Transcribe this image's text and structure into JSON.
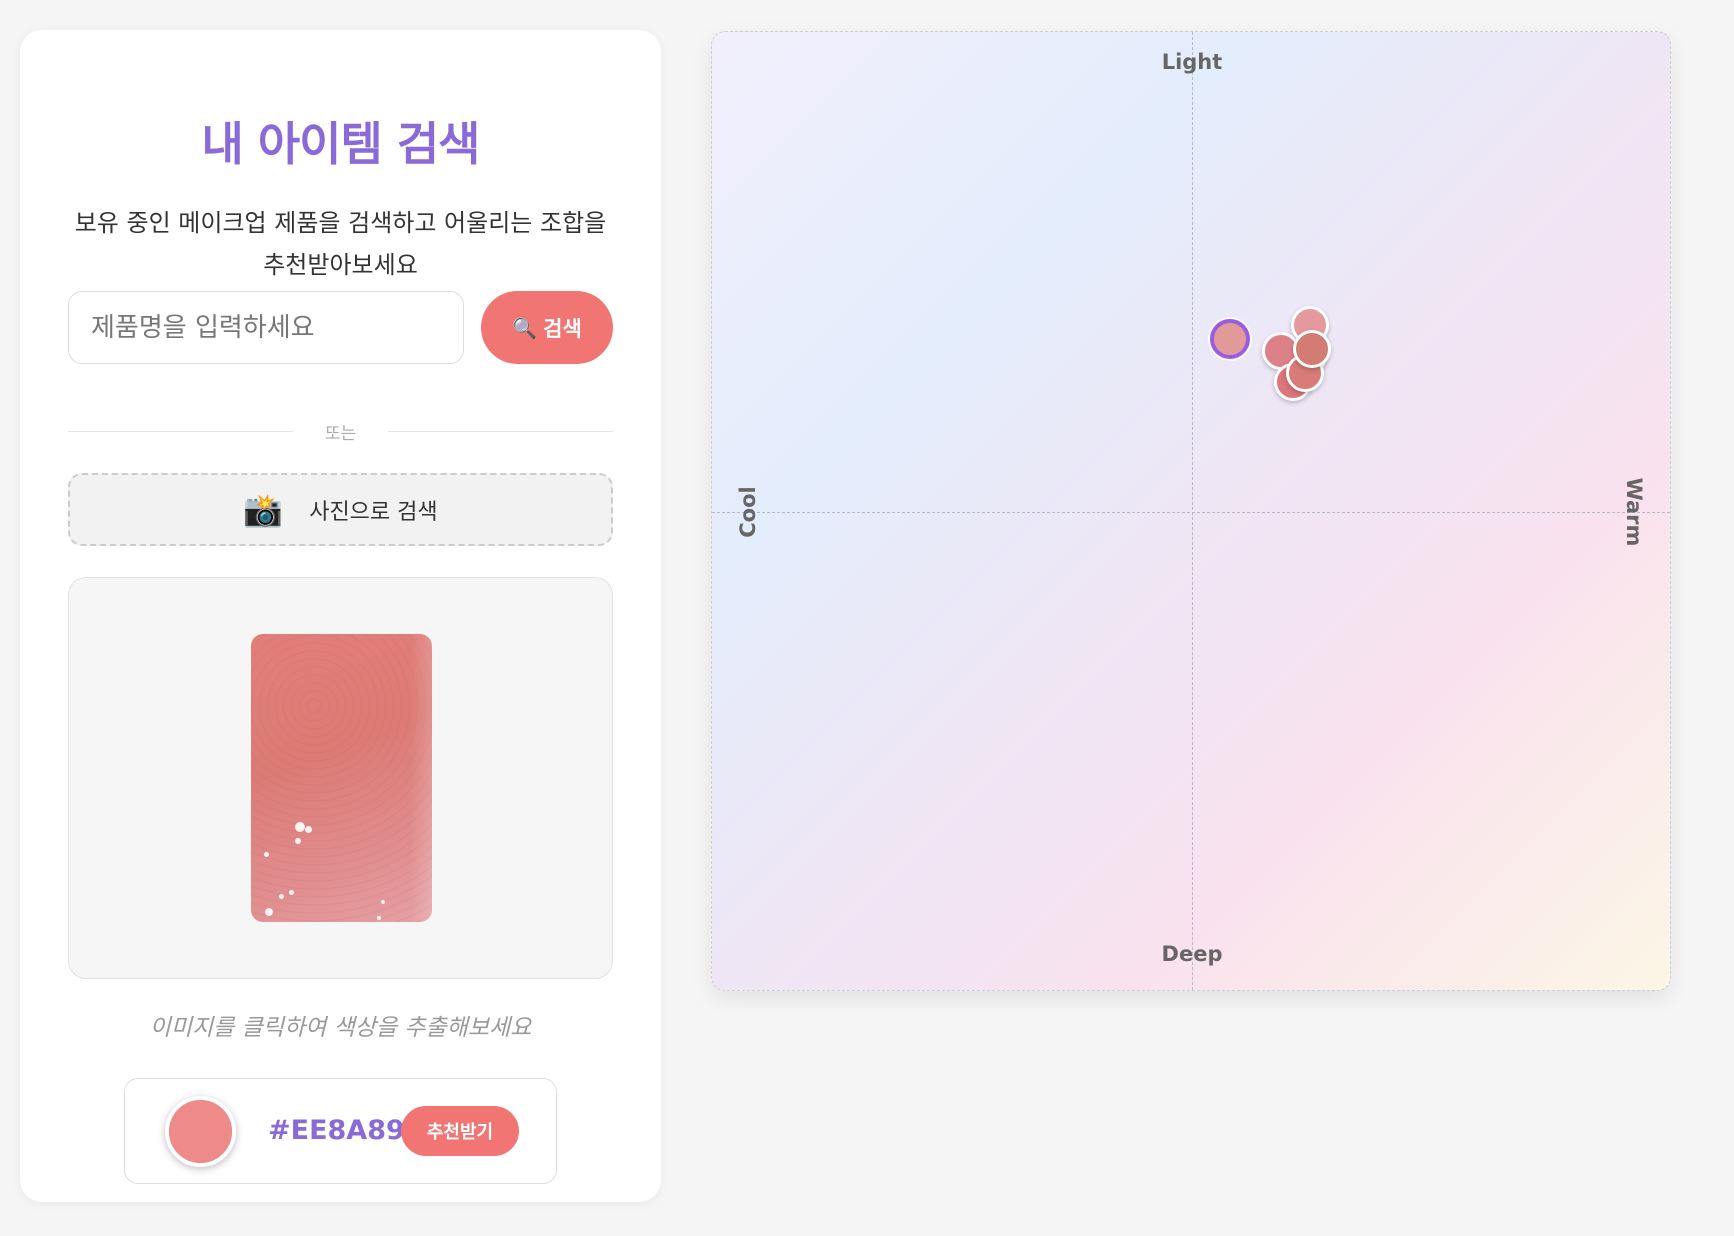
{
  "search_panel": {
    "title": "내 아이템 검색",
    "subtitle": "보유 중인 메이크업 제품을 검색하고 어울리는 조합을 추천받아보세요",
    "search_input": {
      "placeholder": "제품명을 입력하세요",
      "value": ""
    },
    "search_button": {
      "icon": "🔍",
      "label": "검색"
    },
    "divider_text": "또는",
    "photo_search_button": {
      "icon": "📸",
      "label": "사진으로 검색"
    },
    "image_hint": "이미지를 클릭하여 색상을 추출해보세요",
    "extracted_color": {
      "hex": "#EE8A89",
      "recommend_label": "추천받기"
    }
  },
  "color_map": {
    "axis_labels": {
      "top": "Light",
      "bottom": "Deep",
      "left": "Cool",
      "right": "Warm"
    },
    "selected_point": {
      "warmth": 0.08,
      "lightness": 0.36,
      "color": "#e1999a"
    },
    "points": [
      {
        "warmth": 0.245,
        "lightness": 0.39,
        "color": "#e49a9c"
      },
      {
        "warmth": 0.24,
        "lightness": 0.32,
        "color": "#de7b80"
      },
      {
        "warmth": 0.185,
        "lightness": 0.335,
        "color": "#dd8088"
      },
      {
        "warmth": 0.21,
        "lightness": 0.27,
        "color": "#dc767a"
      },
      {
        "warmth": 0.235,
        "lightness": 0.29,
        "color": "#d97b78"
      },
      {
        "warmth": 0.25,
        "lightness": 0.34,
        "color": "#d27c73"
      }
    ]
  }
}
